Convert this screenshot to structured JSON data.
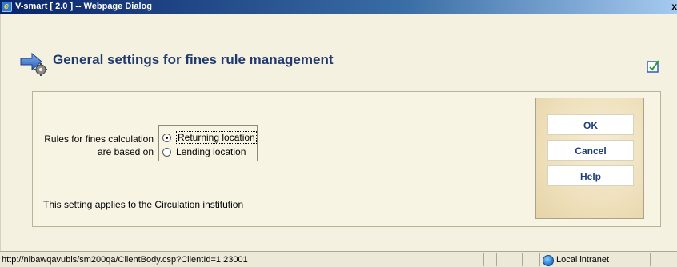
{
  "window": {
    "title": "V-smart [ 2.0 ] -- Webpage Dialog",
    "close_symbol": "x"
  },
  "header": {
    "title": "General settings for fines rule management"
  },
  "form": {
    "label": "Rules for fines calculation are based on",
    "options": [
      {
        "label": "Returning location",
        "checked": true
      },
      {
        "label": "Lending location",
        "checked": false
      }
    ],
    "note": "This setting applies to the Circulation institution"
  },
  "buttons": {
    "ok": "OK",
    "cancel": "Cancel",
    "help": "Help"
  },
  "statusbar": {
    "url": "http://nlbawqavubis/sm200qa/ClientBody.csp?ClientId=1.23001",
    "zone": "Local intranet"
  },
  "colors": {
    "title_text": "#203a6e",
    "button_text": "#1f3d7a",
    "page_background": "#f4f1e1"
  },
  "icons": {
    "header": "arrow-gear-icon",
    "edit": "checkbox-pencil-icon",
    "zone": "globe-icon"
  }
}
